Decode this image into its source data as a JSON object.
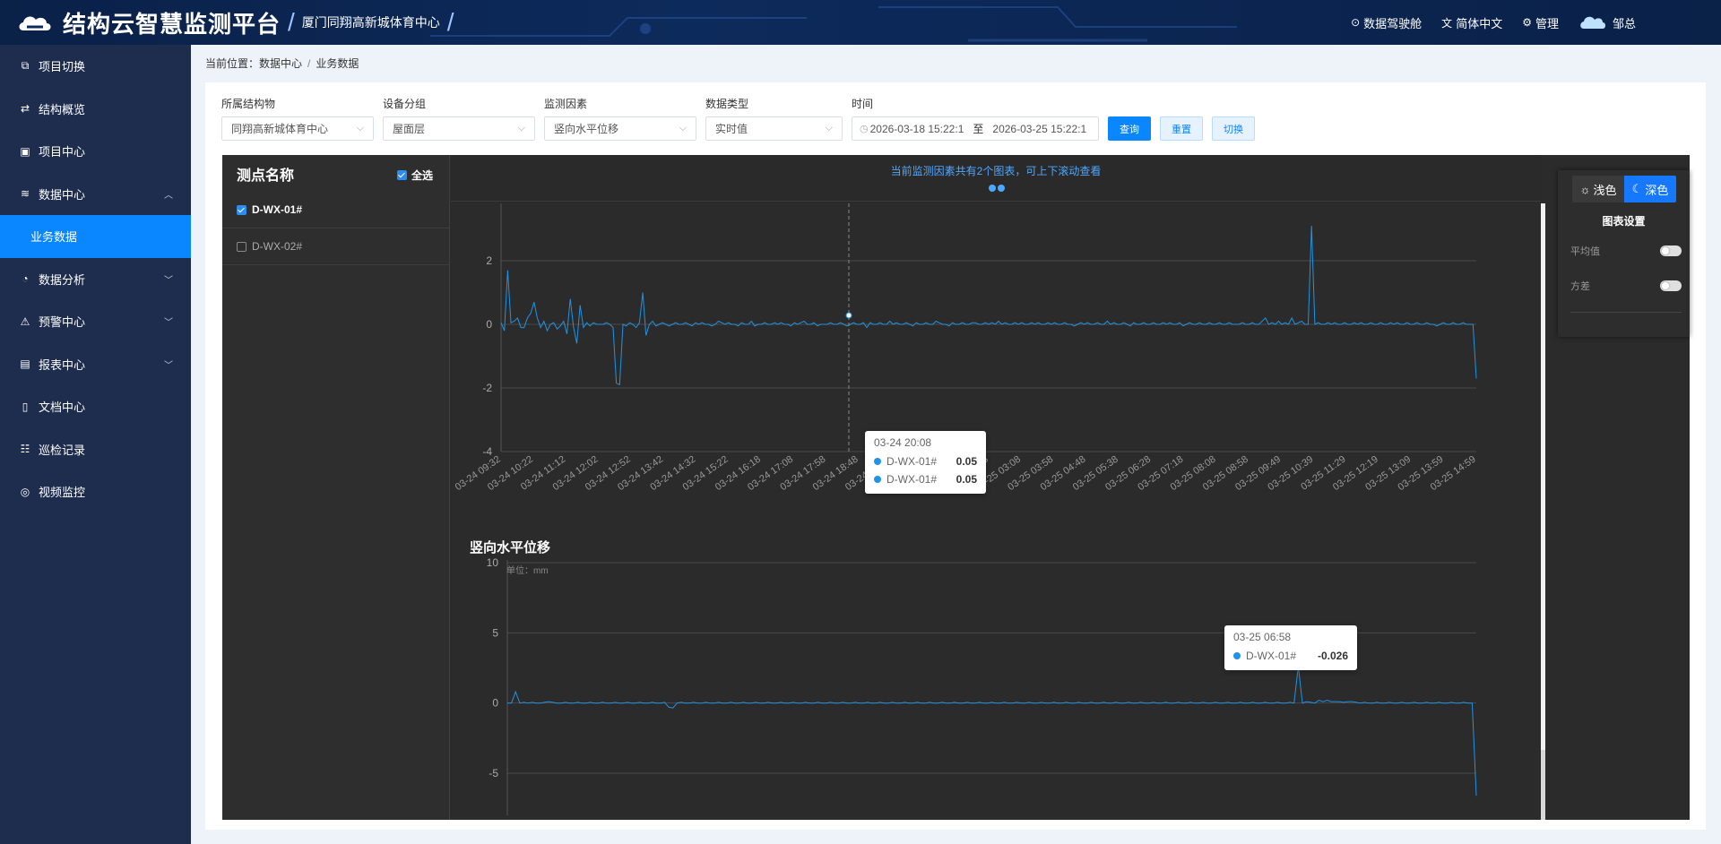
{
  "header": {
    "title": "结构云智慧监测平台",
    "project": "厦门同翔高新城体育中心",
    "nav": [
      {
        "icon": "dashboard-icon",
        "label": "数据驾驶舱"
      },
      {
        "icon": "translate-icon",
        "label": "简体中文"
      },
      {
        "icon": "settings-icon",
        "label": "管理"
      }
    ],
    "user": "邹总"
  },
  "sidebar": {
    "items": [
      {
        "icon": "switch-project-icon",
        "label": "项目切换"
      },
      {
        "icon": "structure-icon",
        "label": "结构概览"
      },
      {
        "icon": "project-center-icon",
        "label": "项目中心"
      },
      {
        "icon": "database-icon",
        "label": "数据中心",
        "expanded": true,
        "sub": "业务数据"
      },
      {
        "icon": "analysis-icon",
        "label": "数据分析"
      },
      {
        "icon": "alarm-icon",
        "label": "预警中心"
      },
      {
        "icon": "report-icon",
        "label": "报表中心"
      },
      {
        "icon": "document-icon",
        "label": "文档中心"
      },
      {
        "icon": "inspection-icon",
        "label": "巡检记录"
      },
      {
        "icon": "video-icon",
        "label": "视频监控"
      }
    ]
  },
  "breadcrumb": {
    "prefix": "当前位置：",
    "parent": "数据中心",
    "sep": "/",
    "current": "业务数据"
  },
  "filters": {
    "structure": {
      "label": "所属结构物",
      "value": "同翔高新城体育中心"
    },
    "group": {
      "label": "设备分组",
      "value": "屋面层"
    },
    "factor": {
      "label": "监测因素",
      "value": "竖向水平位移"
    },
    "datatype": {
      "label": "数据类型",
      "value": "实时值"
    },
    "time": {
      "label": "时间",
      "start": "2026-03-18 15:22:1",
      "to": "至",
      "end": "2026-03-25 15:22:1"
    },
    "buttons": {
      "query": "查询",
      "reset": "重置",
      "switch": "切换"
    }
  },
  "points": {
    "title": "测点名称",
    "select_all": "全选",
    "items": [
      {
        "name": "D-WX-01#",
        "checked": true
      },
      {
        "name": "D-WX-02#",
        "checked": false
      }
    ]
  },
  "chart_header": {
    "tip": "当前监测因素共有2个图表，可上下滚动查看"
  },
  "settings": {
    "light": "浅色",
    "dark": "深色",
    "title": "图表设置",
    "rows": [
      {
        "label": "平均值",
        "on": false
      },
      {
        "label": "方差",
        "on": false
      }
    ]
  },
  "tooltip1": {
    "time": "03-24 20:08",
    "rows": [
      {
        "name": "D-WX-01#",
        "value": "0.05"
      },
      {
        "name": "D-WX-01#",
        "value": "0.05"
      }
    ]
  },
  "tooltip2": {
    "time": "03-25 06:58",
    "rows": [
      {
        "name": "D-WX-01#",
        "value": "-0.026"
      }
    ]
  },
  "colors": {
    "accent": "#0a86ff",
    "series": "#1f93e4",
    "sidebar": "#1e2d4d"
  },
  "chart_data": [
    {
      "type": "line",
      "title": "",
      "x_ticks": [
        "03-24 09:32",
        "03-24 10:22",
        "03-24 11:12",
        "03-24 12:02",
        "03-24 12:52",
        "03-24 13:42",
        "03-24 14:32",
        "03-24 15:22",
        "03-24 16:18",
        "03-24 17:08",
        "03-24 17:58",
        "03-24 18:48",
        "03-24 19:38",
        "03-24 20:28",
        "03-25 01:28",
        "03-25 02:18",
        "03-25 03:08",
        "03-25 03:58",
        "03-25 04:48",
        "03-25 05:38",
        "03-25 06:28",
        "03-25 07:18",
        "03-25 08:08",
        "03-25 08:58",
        "03-25 09:49",
        "03-25 10:39",
        "03-25 11:29",
        "03-25 12:19",
        "03-25 13:09",
        "03-25 13:59",
        "03-25 14:59"
      ],
      "y_ticks": [
        2,
        0,
        -2,
        -4
      ],
      "ylim": [
        -4,
        4
      ],
      "series": [
        {
          "name": "D-WX-01#",
          "values": [
            0.05,
            -0.2,
            1.7,
            0.05,
            0.1,
            0.2,
            -0.1,
            -0.1,
            0.2,
            0.35,
            0.7,
            0.2,
            -0.1,
            0.1,
            -0.2,
            0.0,
            0.05,
            -0.15,
            -0.05,
            0.1,
            -0.3,
            0.8,
            -0.1,
            -0.6,
            0.6,
            -0.1,
            0.05,
            -0.05,
            0.05,
            0.0,
            0.0,
            0.0,
            0.05,
            0.0,
            -0.1,
            -1.85,
            -1.9,
            0.0,
            -0.05,
            0.05,
            0.0,
            -0.1,
            0.05,
            1.0,
            -0.35,
            0.0,
            0.1,
            -0.05,
            0.0,
            0.05,
            0.0,
            -0.05,
            0.0,
            0.05,
            0.0,
            0.0,
            0.05,
            0.0,
            -0.05,
            0.05,
            0.0,
            0.05,
            0.0,
            0.0,
            -0.05,
            0.0,
            0.1,
            0.05,
            0.0,
            0.05,
            0.0,
            0.0,
            -0.05,
            0.05,
            0.0,
            0.0,
            0.1,
            -0.05,
            0.0,
            0.0,
            0.05,
            0.0,
            0.0,
            0.05,
            0.0,
            0.05,
            0.0,
            0.0,
            -0.05,
            0.05,
            0.0,
            0.05,
            0.1,
            0.0,
            0.0,
            0.05,
            -0.05,
            0.0,
            0.0,
            0.0,
            0.05,
            0.0,
            0.0,
            0.05,
            0.0,
            -0.05,
            0.0,
            0.05,
            0.0,
            0.0,
            0.05,
            -0.1,
            0.05,
            0.0,
            0.0,
            0.05,
            0.0,
            0.0,
            0.1,
            0.0,
            0.05,
            0.0,
            0.0,
            0.05,
            0.0,
            -0.05,
            0.05,
            0.0,
            0.0,
            0.05,
            0.0,
            0.0,
            0.1,
            0.05,
            0.0,
            0.0,
            -0.05,
            0.05,
            0.0,
            0.0,
            0.05,
            0.0,
            0.0,
            0.05,
            0.05,
            0.0,
            0.0,
            0.05,
            0.0,
            0.05,
            0.0,
            0.1,
            0.0,
            0.05,
            0.0,
            0.0,
            0.05,
            0.0,
            0.05,
            0.0,
            0.0,
            0.05,
            0.0,
            0.05,
            0.0,
            0.0,
            0.05,
            0.0,
            0.05,
            0.0,
            0.0,
            0.05,
            0.0,
            0.0,
            -0.05,
            0.0,
            0.05,
            0.0,
            0.05,
            0.0,
            0.0,
            0.05,
            0.0,
            0.0,
            0.1,
            0.0,
            0.05,
            0.0,
            0.0,
            0.05,
            0.0,
            -0.05,
            0.05,
            0.0,
            0.0,
            0.05,
            0.0,
            0.0,
            0.05,
            0.0,
            0.0,
            0.05,
            0.0,
            0.05,
            0.0,
            0.0,
            0.05,
            -0.05,
            0.0,
            0.05,
            0.0,
            0.0,
            0.05,
            0.0,
            0.0,
            0.05,
            0.0,
            0.0,
            0.05,
            0.0,
            0.0,
            0.05,
            0.0,
            0.0,
            0.0,
            0.05,
            0.0,
            0.0,
            0.05,
            0.0,
            0.0,
            0.1,
            0.2,
            0.0,
            0.05,
            0.0,
            0.1,
            0.0,
            0.05,
            0.0,
            0.2,
            0.0,
            0.05,
            0.1,
            0.0,
            0.0,
            3.1,
            0.0,
            0.05,
            0.0,
            0.0,
            0.05,
            0.0,
            0.05,
            0.0,
            0.0,
            0.05,
            0.0,
            0.0,
            0.05,
            0.0,
            0.05,
            0.0,
            0.0,
            0.05,
            0.0,
            0.0,
            0.05,
            0.0,
            0.0,
            0.05,
            0.0,
            0.05,
            0.0,
            0.0,
            0.05,
            0.0,
            0.0,
            0.05,
            0.0,
            0.0,
            0.05,
            0.0,
            0.0,
            -0.05,
            0.0,
            0.05,
            0.0,
            0.0,
            0.05,
            0.0,
            0.0,
            0.05,
            0.0,
            0.0,
            0.0,
            -1.7
          ]
        }
      ]
    },
    {
      "type": "line",
      "title": "竖向水平位移",
      "ylabel": "单位：mm",
      "y_ticks": [
        10,
        5,
        0,
        -5
      ],
      "ylim": [
        -8,
        10
      ],
      "series": [
        {
          "name": "D-WX-01#",
          "values": [
            0.0,
            0.0,
            0.8,
            0.0,
            0.05,
            0.0,
            0.05,
            0.0,
            0.0,
            0.05,
            0.1,
            0.05,
            0.0,
            0.0,
            0.05,
            0.0,
            0.0,
            0.05,
            0.0,
            0.0,
            0.05,
            0.0,
            0.0,
            0.05,
            0.0,
            0.0,
            0.05,
            0.0,
            0.0,
            0.05,
            0.0,
            0.0,
            0.05,
            0.0,
            0.0,
            0.05,
            0.0,
            0.0,
            0.05,
            -0.3,
            -0.35,
            0.0,
            0.05,
            0.0,
            0.0,
            0.05,
            0.0,
            0.0,
            0.05,
            0.0,
            0.0,
            0.05,
            0.0,
            0.0,
            0.05,
            0.0,
            0.0,
            0.05,
            0.0,
            0.0,
            0.05,
            0.0,
            0.0,
            0.05,
            0.0,
            0.0,
            0.05,
            0.0,
            0.0,
            0.05,
            0.0,
            0.0,
            0.05,
            0.0,
            0.0,
            0.05,
            0.0,
            0.0,
            0.05,
            0.0,
            0.0,
            0.05,
            0.0,
            0.0,
            0.05,
            0.0,
            0.0,
            0.05,
            0.0,
            0.0,
            0.05,
            0.0,
            0.0,
            0.05,
            0.0,
            0.0,
            0.05,
            0.0,
            0.0,
            0.05,
            0.0,
            0.0,
            0.05,
            0.0,
            0.0,
            0.05,
            0.0,
            0.0,
            0.05,
            0.0,
            0.0,
            0.05,
            0.0,
            0.0,
            0.05,
            0.0,
            0.0,
            0.05,
            0.0,
            0.0,
            0.05,
            0.0,
            0.0,
            0.05,
            0.0,
            0.0,
            0.05,
            0.0,
            0.0,
            0.05,
            0.0,
            0.0,
            0.05,
            0.0,
            0.0,
            0.05,
            0.0,
            0.0,
            0.05,
            0.0,
            0.0,
            0.05,
            0.0,
            0.0,
            0.05,
            0.0,
            0.0,
            0.05,
            0.0,
            0.0,
            0.05,
            0.0,
            0.0,
            0.05,
            0.0,
            0.0,
            0.05,
            0.0,
            0.0,
            0.05,
            0.0,
            0.0,
            0.05,
            0.0,
            0.0,
            0.05,
            0.0,
            0.0,
            0.05,
            0.0,
            0.0,
            0.05,
            0.0,
            0.0,
            0.05,
            0.0,
            0.0,
            0.05,
            0.0,
            0.0,
            0.05,
            0.0,
            0.0,
            0.05,
            0.0,
            0.0,
            0.05,
            0.0,
            0.0,
            0.05,
            0.0,
            2.6,
            0.0,
            0.1,
            0.05,
            0.0,
            0.2,
            0.1,
            0.2,
            0.1,
            0.1,
            0.1,
            0.05,
            0.1,
            0.1,
            0.05,
            0.0,
            0.05,
            0.0,
            0.0,
            0.05,
            0.0,
            0.0,
            0.05,
            0.0,
            0.0,
            0.05,
            0.0,
            0.0,
            0.05,
            0.0,
            0.0,
            0.05,
            0.0,
            0.0,
            0.05,
            0.0,
            0.0,
            0.05,
            0.0,
            0.0,
            0.05,
            0.0,
            0.0,
            -6.6
          ]
        }
      ]
    }
  ]
}
